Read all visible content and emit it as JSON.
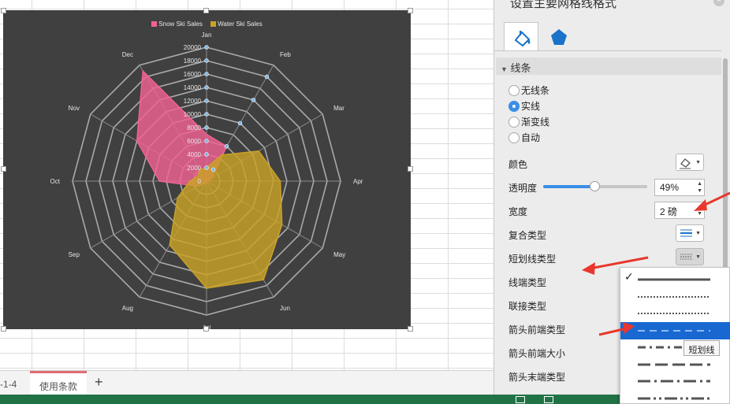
{
  "pane": {
    "title": "设置主要网格线格式",
    "section": "线条",
    "line_options": [
      {
        "label": "无线条",
        "selected": false
      },
      {
        "label": "实线",
        "selected": true
      },
      {
        "label": "渐变线",
        "selected": false
      },
      {
        "label": "自动",
        "selected": false
      }
    ],
    "color_label": "颜色",
    "transparency_label": "透明度",
    "transparency_value": "49%",
    "transparency_fraction": 0.49,
    "width_label": "宽度",
    "width_value": "2 磅",
    "compound_label": "复合类型",
    "dash_label": "短划线类型",
    "cap_label": "线端类型",
    "join_label": "联接类型",
    "arrow_begin_type_label": "箭头前端类型",
    "arrow_begin_size_label": "箭头前端大小",
    "arrow_end_type_label": "箭头末端类型"
  },
  "dash_menu": {
    "options": [
      "solid",
      "round-dot",
      "square-dot",
      "dash",
      "dash-dot",
      "long-dash",
      "long-dash-dot",
      "long-dash-dot-dot"
    ],
    "checked": "solid",
    "highlighted": "dash",
    "tooltip": "短划线"
  },
  "sheet_tabs": {
    "prev_tab": "-1-4",
    "active_tab": "使用条款",
    "add_label": "+"
  },
  "colors": {
    "snow": "#f06292",
    "water": "#c9a227",
    "chart_bg": "#404040",
    "accent": "#3a8ee6",
    "status_bar": "#217346",
    "arrow": "#e8372c"
  },
  "chart_data": {
    "type": "radar",
    "categories": [
      "Jan",
      "Feb",
      "Mar",
      "Apr",
      "May",
      "Jun",
      "Jul",
      "Aug",
      "Sep",
      "Oct",
      "Nov",
      "Dec"
    ],
    "rticks": [
      "0",
      "2000",
      "4000",
      "6000",
      "8000",
      "10000",
      "12000",
      "14000",
      "16000",
      "18000",
      "20000"
    ],
    "rlim": [
      0,
      20000
    ],
    "legend_position": "top",
    "series": [
      {
        "name": "Snow Ski Sales",
        "color": "#f06292",
        "values": [
          7000,
          6000,
          1000,
          500,
          200,
          100,
          100,
          300,
          1500,
          7000,
          12000,
          19000
        ]
      },
      {
        "name": "Water Ski Sales",
        "color": "#c9a227",
        "values": [
          2000,
          4500,
          9000,
          11000,
          13000,
          17000,
          16000,
          11000,
          5000,
          2500,
          1500,
          2000
        ]
      }
    ],
    "marker_values": [
      20000,
      18000,
      16000,
      14000,
      12000,
      10000,
      8000,
      6000,
      4000,
      2000
    ]
  }
}
